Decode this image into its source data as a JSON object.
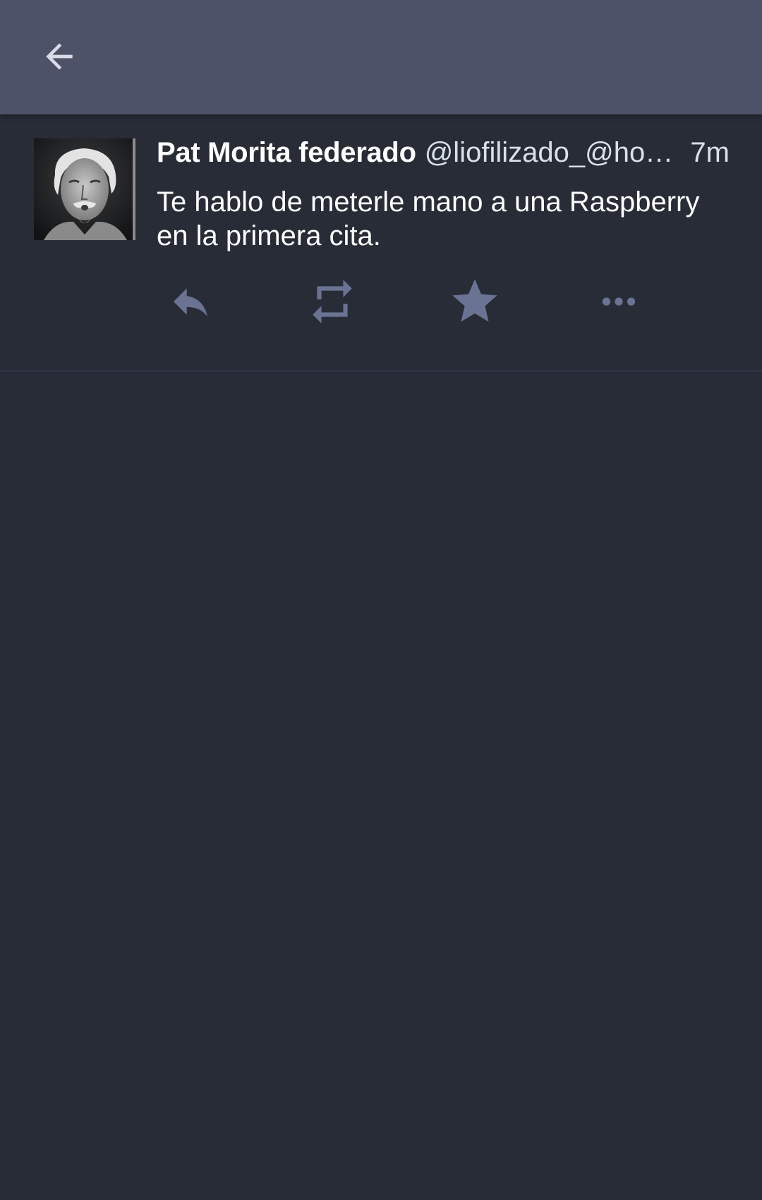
{
  "topbar": {
    "back_icon": "arrow-left-icon"
  },
  "status": {
    "display_name": "Pat Morita federado",
    "handle": "@liofilizado_@ho…",
    "time": "7m",
    "content": "Te hablo de meterle mano a una Raspberry en la primera cita.",
    "avatar": "avatar-photo"
  },
  "actions": [
    {
      "icon": "reply-icon"
    },
    {
      "icon": "boost-icon"
    },
    {
      "icon": "star-icon"
    },
    {
      "icon": "more-icon"
    }
  ],
  "colors": {
    "topbar": "#4d5268",
    "background": "#282c37",
    "icon_muted": "#6b7394",
    "text_primary": "#ffffff",
    "text_secondary": "#d9e1e8"
  }
}
